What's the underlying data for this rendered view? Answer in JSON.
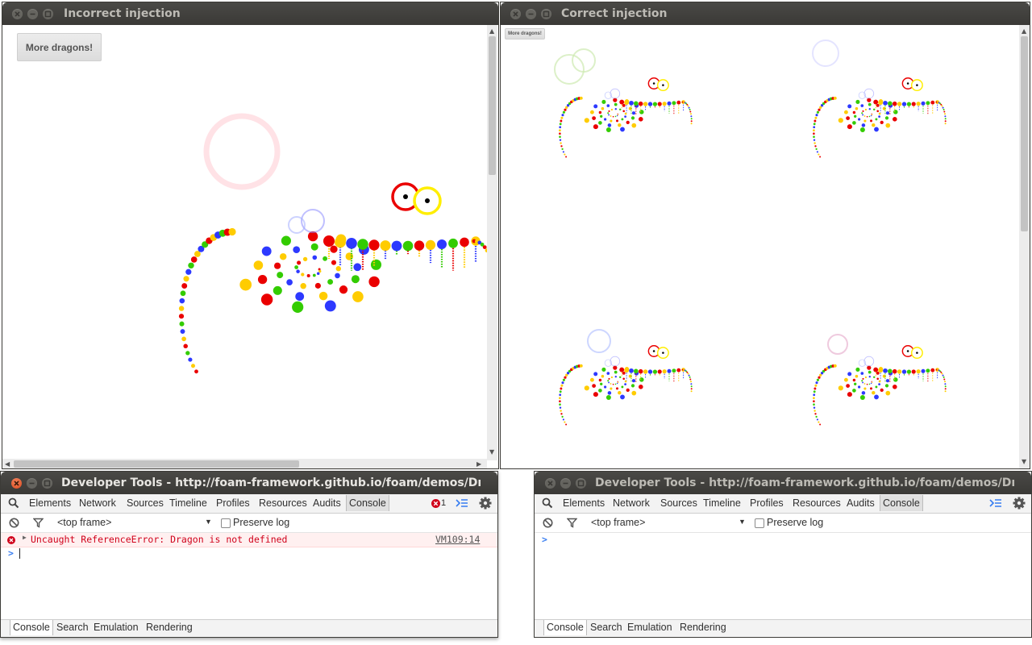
{
  "windows": {
    "incorrect": {
      "title": "Incorrect injection",
      "button_label": "More dragons!"
    },
    "correct": {
      "title": "Correct injection",
      "button_label": "More dragons!"
    }
  },
  "devtools_left": {
    "title": "Developer Tools - http://foam-framework.github.io/foam/demos/Dragon",
    "tabs": [
      "Elements",
      "Network",
      "Sources",
      "Timeline",
      "Profiles",
      "Resources",
      "Audits",
      "Console"
    ],
    "active_tab": "Console",
    "error_count": "1",
    "frame_select": "<top frame>",
    "preserve_log_label": "Preserve log",
    "error_message": "Uncaught ReferenceError: Dragon is not defined",
    "error_source": "VM109:14",
    "prompt": ">",
    "drawer_tabs": [
      "Console",
      "Search",
      "Emulation",
      "Rendering"
    ]
  },
  "devtools_right": {
    "title": "Developer Tools - http://foam-framework.github.io/foam/demos/Dragon",
    "tabs": [
      "Elements",
      "Network",
      "Sources",
      "Timeline",
      "Profiles",
      "Resources",
      "Audits",
      "Console"
    ],
    "active_tab": "Console",
    "frame_select": "<top frame>",
    "preserve_log_label": "Preserve log",
    "prompt": ">",
    "drawer_tabs": [
      "Console",
      "Search",
      "Emulation",
      "Rendering"
    ]
  },
  "dragon_colors": [
    "#ea0000",
    "#ffcc00",
    "#2d39ff",
    "#33cc00"
  ],
  "colors": {
    "error_red": "#d0021b",
    "link_blue": "#367cf1",
    "titlebar": "#3c3b37"
  }
}
